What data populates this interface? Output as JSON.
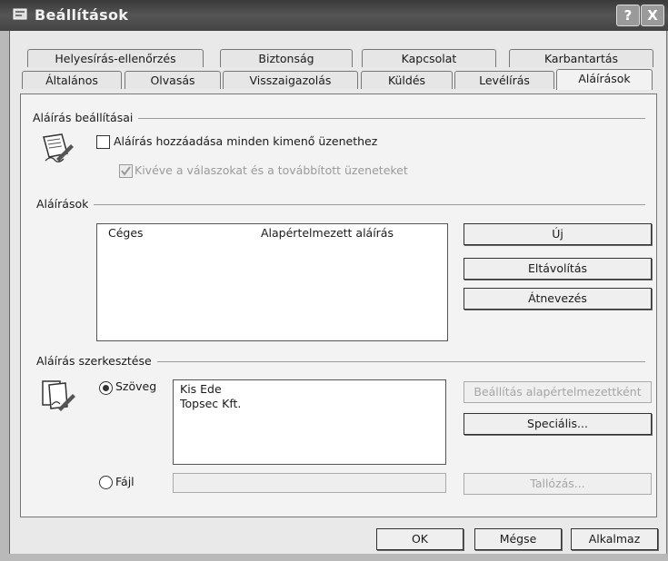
{
  "window": {
    "title": "Beállítások",
    "help_label": "?",
    "close_label": "X"
  },
  "tabs_back": [
    "Helyesírás-ellenőrzés",
    "Biztonság",
    "Kapcsolat",
    "Karbantartás"
  ],
  "tabs_front": [
    "Általános",
    "Olvasás",
    "Visszaigazolás",
    "Küldés",
    "Levélírás",
    "Aláírások"
  ],
  "active_tab": "Aláírások",
  "settings_group": {
    "title": "Aláírás beállításai",
    "add_signature_label": "Aláírás hozzáadása minden kimenő üzenethez",
    "add_signature_checked": false,
    "except_replies_label": "Kivéve a válaszokat és a továbbított üzeneteket",
    "except_replies_checked": true,
    "except_replies_enabled": false
  },
  "signatures_group": {
    "title": "Aláírások",
    "items": [
      {
        "name": "Céges",
        "status": "Alapértelmezett aláírás"
      }
    ],
    "new_button": "Új",
    "remove_button": "Eltávolítás",
    "rename_button": "Átnevezés"
  },
  "edit_group": {
    "title": "Aláírás szerkesztése",
    "text_radio_label": "Szöveg",
    "text_selected": true,
    "text_content": [
      "Kis Ede",
      "Topsec Kft."
    ],
    "set_default_button": "Beállítás alapértelmezettként",
    "advanced_button": "Speciális...",
    "file_radio_label": "Fájl",
    "file_path": "",
    "browse_button": "Tallózás..."
  },
  "footer": {
    "ok": "OK",
    "cancel": "Mégse",
    "apply": "Alkalmaz"
  }
}
